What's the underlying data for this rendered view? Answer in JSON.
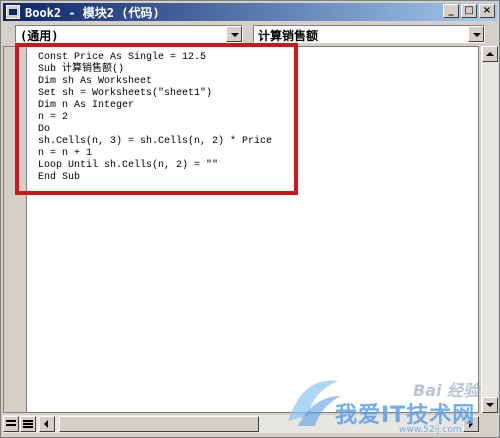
{
  "window": {
    "title": "Book2 - 模块2 (代码)",
    "buttons": {
      "minimize": "_",
      "maximize": "□",
      "close": "×"
    }
  },
  "object_combo": {
    "value": "(通用)"
  },
  "procedure_combo": {
    "value": "计算销售额"
  },
  "code_lines": [
    "Const Price As Single = 12.5",
    "Sub 计算销售额()",
    "Dim sh As Worksheet",
    "Set sh = Worksheets(\"sheet1\")",
    "Dim n As Integer",
    "n = 2",
    "Do",
    "sh.Cells(n, 3) = sh.Cells(n, 2) * Price",
    "n = n + 1",
    "Loop Until sh.Cells(n, 2) = \"\"",
    "End Sub"
  ],
  "highlight": {
    "color": "#d0141c"
  },
  "watermark": {
    "text": "我爱IT技术网",
    "url": "www.52ij.com",
    "brand": "Bai 经验"
  }
}
